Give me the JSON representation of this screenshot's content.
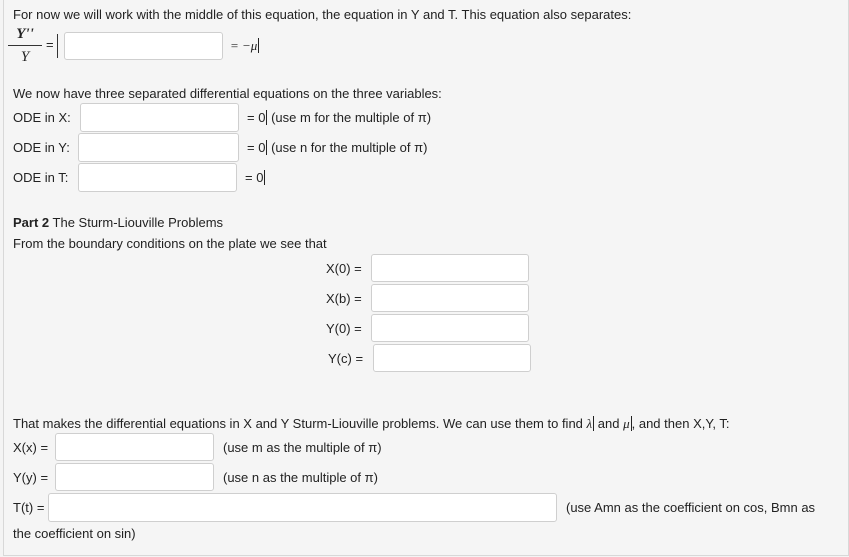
{
  "intro": {
    "text": "For now we will work with the middle of this equation, the equation in Y and T. This equation also separates:",
    "fraction_numerator": "Y''",
    "fraction_denominator": "Y",
    "equals": "=",
    "rhs": "= −μ"
  },
  "three_odes": {
    "heading": "We now have three separated differential equations on the three variables:",
    "rows": [
      {
        "label": "ODE in X:",
        "rhs": "= 0",
        "note": "(use m for the multiple of π)"
      },
      {
        "label": "ODE in Y:",
        "rhs": "= 0",
        "note": "(use n for the multiple of π)"
      },
      {
        "label": "ODE in T:",
        "rhs": "= 0",
        "note": ""
      }
    ]
  },
  "part2": {
    "title_bold": "Part 2",
    "title_rest": " The Sturm-Liouville Problems",
    "intro": "From the boundary conditions on the plate we see that",
    "conditions": [
      {
        "label": "X(0) ="
      },
      {
        "label": "X(b) ="
      },
      {
        "label": "Y(0) ="
      },
      {
        "label": "Y(c) ="
      }
    ]
  },
  "conclusion": {
    "text_before": "That makes the differential equations in X and Y Sturm-Liouville problems. We can use them to find ",
    "lambda": "λ",
    "text_and": " and ",
    "mu": "μ",
    "text_after": ", and then X,Y, T:",
    "rows": [
      {
        "label": "X(x) =",
        "note": "(use m as the multiple of π)"
      },
      {
        "label": "Y(y) =",
        "note": "(use n as the multiple of π)"
      },
      {
        "label": "T(t) =",
        "note": "(use Amn as the coefficient on cos, Bmn as"
      }
    ],
    "wrap_text": "the coefficient on sin)"
  }
}
